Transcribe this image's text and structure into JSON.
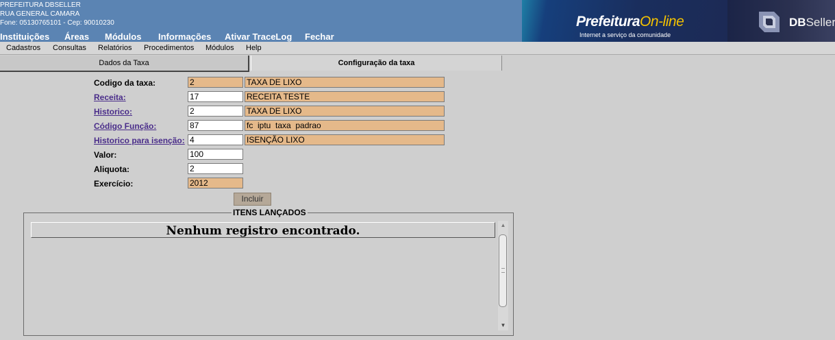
{
  "header": {
    "line1": "PREFEITURA DBSELLER",
    "line2": "RUA GENERAL CAMARA",
    "line3": "Fone: 05130765101  -  Cep: 90010230",
    "nav": [
      "Instituições",
      "Áreas",
      "Módulos",
      "Informações",
      "Ativar TraceLog",
      "Fechar"
    ],
    "brand_title_a": "Prefeitura",
    "brand_title_b": "On-line",
    "brand_subtitle": "Internet a serviço da comunidade",
    "vendor_a": "DB",
    "vendor_b": "Seller"
  },
  "menubar": [
    "Cadastros",
    "Consultas",
    "Relatórios",
    "Procedimentos",
    "Módulos",
    "Help"
  ],
  "tabs": [
    "Dados da Taxa",
    "Configuração da taxa"
  ],
  "form": {
    "codigo_taxa": {
      "label": "Codigo da taxa:",
      "value": "2",
      "desc": "TAXA DE LIXO"
    },
    "receita": {
      "label": "Receita:",
      "value": "17",
      "desc": "RECEITA TESTE"
    },
    "historico": {
      "label": "Historico:",
      "value": "2",
      "desc": "TAXA DE LIXO"
    },
    "codigo_funcao": {
      "label": "Código Função:",
      "value": "87",
      "desc": "fc  iptu  taxa  padrao"
    },
    "historico_isencao": {
      "label": "Historico para isenção:",
      "value": "4",
      "desc": "ISENÇÃO LIXO"
    },
    "valor": {
      "label": "Valor:",
      "value": "100"
    },
    "aliquota": {
      "label": "Aliquota:",
      "value": "2"
    },
    "exercicio": {
      "label": "Exercício:",
      "value": "2012"
    },
    "incluir_label": "Incluir"
  },
  "itens": {
    "legend": "ITENS LANÇADOS",
    "empty_message": "Nenhum registro encontrado."
  },
  "colors": {
    "header_bg": "#5b84b3",
    "readonly_field": "#e5b98a",
    "link": "#4a2d8a"
  }
}
